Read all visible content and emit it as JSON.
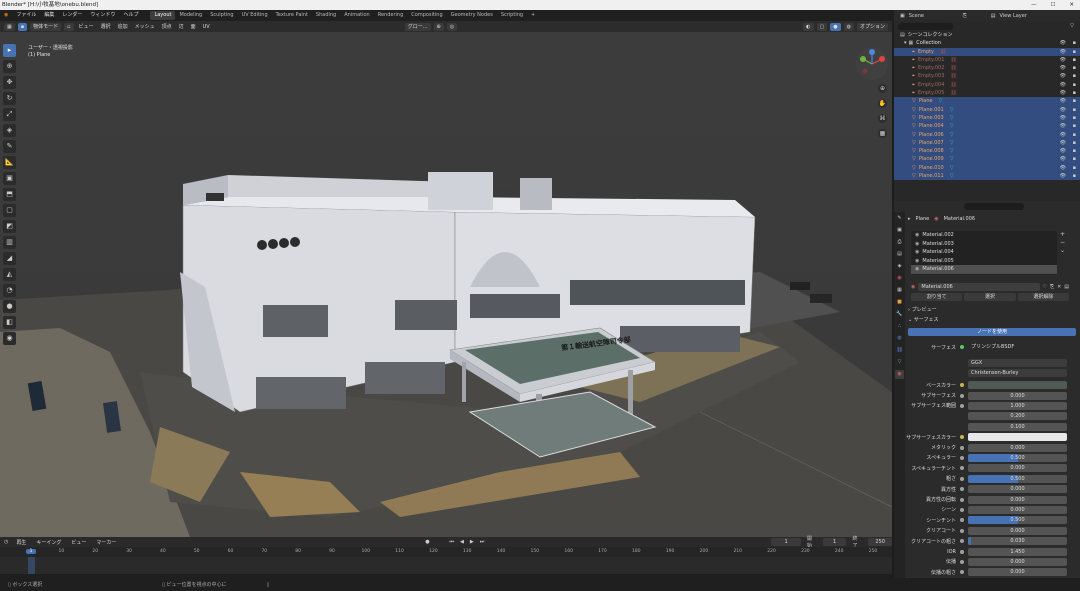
{
  "window": {
    "title": "Blender* [H:\\小牧基地\\onebu.blend]"
  },
  "menu": [
    "ファイル",
    "編集",
    "レンダー",
    "ウィンドウ",
    "ヘルプ"
  ],
  "workspaces": [
    "Layout",
    "Modeling",
    "Sculpting",
    "UV Editing",
    "Texture Paint",
    "Shading",
    "Animation",
    "Rendering",
    "Compositing",
    "Geometry Nodes",
    "Scripting",
    "+"
  ],
  "active_workspace": "Layout",
  "scene": {
    "label": "Scene",
    "view_layer": "View Layer"
  },
  "viewport_header": {
    "mode": "物体モード",
    "menus": [
      "ビュー",
      "選択",
      "追加",
      "メッシュ",
      "頂点",
      "辺",
      "面",
      "UV"
    ],
    "transform": "グロー...",
    "options": "オプション"
  },
  "viewport": {
    "view_name": "ユーザー・透視投影",
    "object_name": "(1) Plane",
    "sign_text": "第１輸送航空隊司令部"
  },
  "toolbar_icons": [
    "select-box-icon",
    "cursor-icon",
    "move-icon",
    "rotate-icon",
    "scale-icon",
    "transform-icon",
    "annotate-icon",
    "measure-icon",
    "add-cube-icon",
    "extrude-icon",
    "inset-icon",
    "bevel-icon",
    "loop-cut-icon",
    "knife-icon",
    "poly-build-icon",
    "spin-icon",
    "smooth-icon",
    "edge-slide-icon",
    "shrink-icon",
    "shear-icon",
    "rip-icon"
  ],
  "outliner": {
    "root": "シーンコレクション",
    "collection": "Collection",
    "items": [
      {
        "name": "Empty",
        "type": "empty",
        "selected": true
      },
      {
        "name": "Empty.001",
        "type": "empty",
        "selected": false
      },
      {
        "name": "Empty.002",
        "type": "empty",
        "selected": false
      },
      {
        "name": "Empty.003",
        "type": "empty",
        "selected": false
      },
      {
        "name": "Empty.004",
        "type": "empty",
        "selected": false
      },
      {
        "name": "Empty.005",
        "type": "empty",
        "selected": false
      },
      {
        "name": "Plane",
        "type": "mesh",
        "selected": true
      },
      {
        "name": "Plane.001",
        "type": "mesh",
        "selected": true
      },
      {
        "name": "Plane.003",
        "type": "mesh",
        "selected": true
      },
      {
        "name": "Plane.004",
        "type": "mesh",
        "selected": true
      },
      {
        "name": "Plane.006",
        "type": "mesh",
        "selected": true
      },
      {
        "name": "Plane.007",
        "type": "mesh",
        "selected": true
      },
      {
        "name": "Plane.008",
        "type": "mesh",
        "selected": true
      },
      {
        "name": "Plane.009",
        "type": "mesh",
        "selected": true
      },
      {
        "name": "Plane.010",
        "type": "mesh",
        "selected": true
      },
      {
        "name": "Plane.011",
        "type": "mesh",
        "selected": true
      }
    ]
  },
  "properties": {
    "object": "Plane",
    "material_crumb": "Material.006",
    "slots": [
      "Material.002",
      "Material.003",
      "Material.004",
      "Material.005",
      "Material.006"
    ],
    "active_slot": "Material.006",
    "material_name": "Material.006",
    "assign": "割り当て",
    "select": "選択",
    "deselect": "選択解除",
    "preview": "プレビュー",
    "surface_panel": "サーフェス",
    "use_nodes": "ノードを使用",
    "surface_label": "サーフェス",
    "surface_value": "プリンシプルBSDF",
    "distribution": "GGX",
    "subsurface_method": "Christensen-Burley",
    "fields": [
      {
        "label": "ベースカラー",
        "value": "",
        "kind": "color",
        "color": "#4f5a52"
      },
      {
        "label": "サブサーフェス",
        "value": "0.000",
        "fill": 0
      },
      {
        "label": "サブサーフェス範囲",
        "value": "1.000",
        "fill": 0
      },
      {
        "label": "",
        "value": "0.200",
        "fill": 0
      },
      {
        "label": "",
        "value": "0.100",
        "fill": 0
      },
      {
        "label": "サブサーフェスカラー",
        "value": "",
        "kind": "color",
        "color": "#e8e8e8"
      },
      {
        "label": "メタリック",
        "value": "0.000",
        "fill": 0
      },
      {
        "label": "スペキュラー",
        "value": "0.500",
        "fill": 0.5
      },
      {
        "label": "スペキュラーチント",
        "value": "0.000",
        "fill": 0
      },
      {
        "label": "粗さ",
        "value": "0.500",
        "fill": 0.5
      },
      {
        "label": "異方性",
        "value": "0.000",
        "fill": 0
      },
      {
        "label": "異方性の回転",
        "value": "0.000",
        "fill": 0
      },
      {
        "label": "シーン",
        "value": "0.000",
        "fill": 0
      },
      {
        "label": "シーンチント",
        "value": "0.500",
        "fill": 0.5
      },
      {
        "label": "クリアコート",
        "value": "0.000",
        "fill": 0
      },
      {
        "label": "クリアコートの粗さ",
        "value": "0.030",
        "fill": 0.03
      },
      {
        "label": "IOR",
        "value": "1.450",
        "fill": 0
      },
      {
        "label": "伝播",
        "value": "0.000",
        "fill": 0
      },
      {
        "label": "伝播の粗さ",
        "value": "0.000",
        "fill": 0
      },
      {
        "label": "放射",
        "value": "",
        "kind": "color",
        "color": "#000000"
      }
    ]
  },
  "timeline": {
    "menus": [
      "再生",
      "キーイング",
      "ビュー",
      "マーカー"
    ],
    "current_frame": "1",
    "start_label": "開始",
    "start": "1",
    "end_label": "終了",
    "end": "250",
    "ticks": [
      "1",
      "10",
      "20",
      "30",
      "40",
      "50",
      "60",
      "70",
      "80",
      "90",
      "100",
      "110",
      "120",
      "130",
      "140",
      "150",
      "160",
      "170",
      "180",
      "190",
      "200",
      "210",
      "220",
      "230",
      "240",
      "250"
    ]
  },
  "status": {
    "left": "ボックス選択",
    "middle": "ビュー位置を視点の中心に"
  }
}
